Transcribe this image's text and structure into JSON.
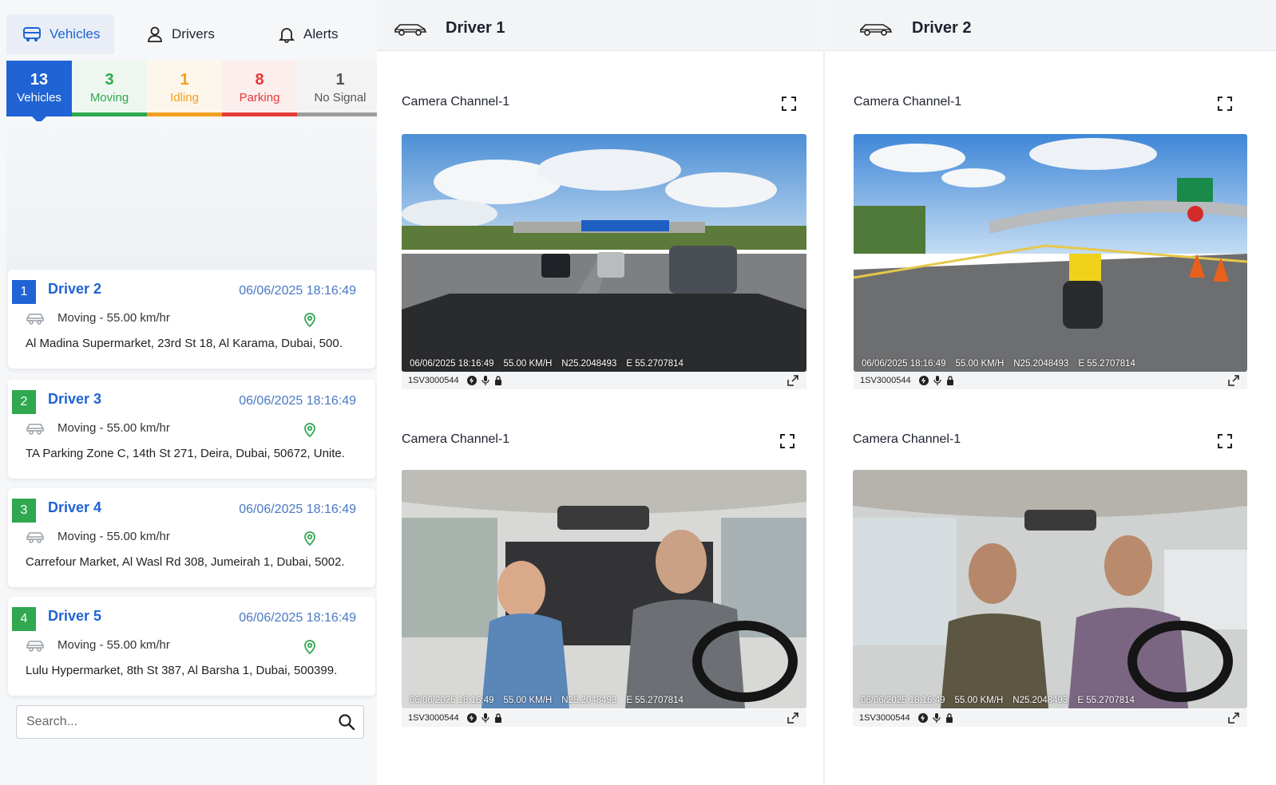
{
  "nav": {
    "tabs": [
      {
        "label": "Vehicles",
        "icon": "bus-icon",
        "active": true
      },
      {
        "label": "Drivers",
        "icon": "user-icon",
        "active": false
      },
      {
        "label": "Alerts",
        "icon": "bell-icon",
        "active": false
      }
    ]
  },
  "status": [
    {
      "count": "13",
      "label": "Vehicles",
      "color": "#1f63d4"
    },
    {
      "count": "3",
      "label": "Moving",
      "color": "#2fa84f"
    },
    {
      "count": "1",
      "label": "Idling",
      "color": "#f0a020"
    },
    {
      "count": "8",
      "label": "Parking",
      "color": "#e53935"
    },
    {
      "count": "1",
      "label": "No Signal",
      "color": "#9e9e9e"
    }
  ],
  "vehicles": [
    {
      "index": "1",
      "name": "Driver 2",
      "time": "06/06/2025 18:16:49",
      "state": "Moving - 55.00 km/hr",
      "address": "Al Madina Supermarket, 23rd St 18, Al Karama, Dubai, 500.",
      "badge_color": "#1f63d4"
    },
    {
      "index": "2",
      "name": "Driver 3",
      "time": "06/06/2025 18:16:49",
      "state": "Moving - 55.00 km/hr",
      "address": "TA Parking Zone C, 14th St 271, Deira, Dubai, 50672, Unite.",
      "badge_color": "#2fa84f"
    },
    {
      "index": "3",
      "name": "Driver 4",
      "time": "06/06/2025 18:16:49",
      "state": "Moving - 55.00 km/hr",
      "address": "Carrefour Market, Al Wasl Rd 308, Jumeirah 1, Dubai, 5002.",
      "badge_color": "#2fa84f"
    },
    {
      "index": "4",
      "name": "Driver 5",
      "time": "06/06/2025 18:16:49",
      "state": "Moving - 55.00 km/hr",
      "address": "Lulu Hypermarket, 8th St 387, Al Barsha 1, Dubai, 500399.",
      "badge_color": "#2fa84f"
    }
  ],
  "search": {
    "placeholder": "Search..."
  },
  "panels": [
    {
      "title": "Driver 1"
    },
    {
      "title": "Driver 2"
    }
  ],
  "cameras": [
    {
      "label": "Camera Channel-1",
      "scene": "road",
      "date": "06/06/2025 18:16:49",
      "speed": "55.00 KM/H",
      "lat": "N25.2048493",
      "lon": "E 55.2707814",
      "device": "1SV3000544"
    },
    {
      "label": "Camera Channel-1",
      "scene": "road",
      "date": "06/06/2025 18:16:49",
      "speed": "55.00 KM/H",
      "lat": "N25.2048493",
      "lon": "E 55.2707814",
      "device": "1SV3000544"
    },
    {
      "label": "Camera Channel-1",
      "scene": "cabin",
      "date": "06/06/2025 18:16:49",
      "speed": "55.00 KM/H",
      "lat": "N25.2048493",
      "lon": "E 55.2707814",
      "device": "1SV3000544"
    },
    {
      "label": "Camera Channel-1",
      "scene": "cabin",
      "date": "06/06/2025 18:16:49",
      "speed": "55.00 KM/H",
      "lat": "N25.2048493",
      "lon": "E 55.2707814",
      "device": "1SV3000544"
    }
  ],
  "colors": {
    "accent": "#1f63d4",
    "pin": "#2fa84f"
  }
}
